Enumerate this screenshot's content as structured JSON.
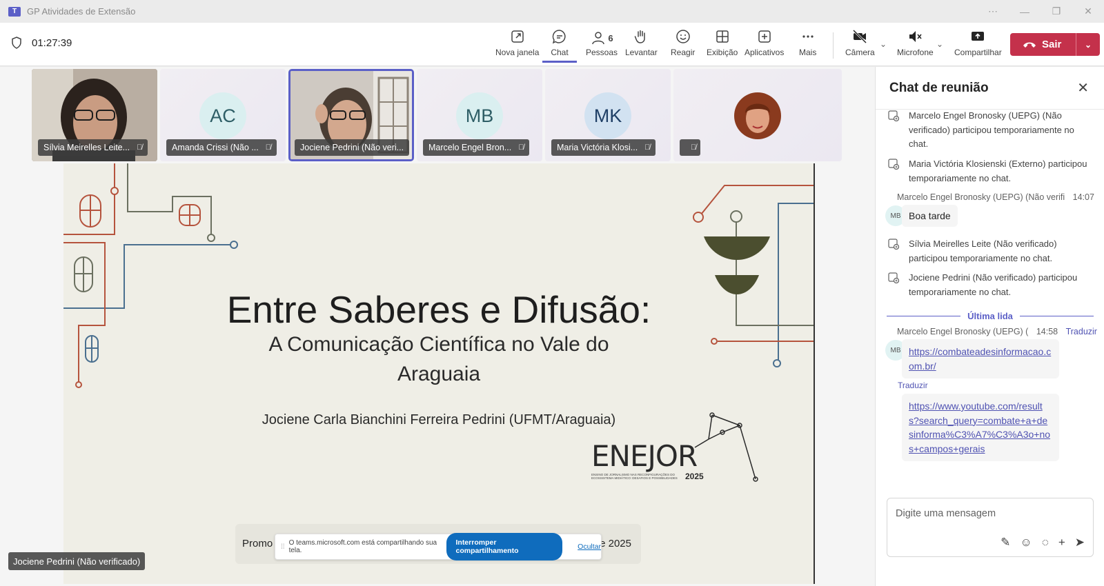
{
  "window": {
    "title": "GP Atividades de Extensão",
    "controls": [
      "⋯",
      "—",
      "❐",
      "✕"
    ]
  },
  "meeting": {
    "elapsed": "01:27:39"
  },
  "toolbar": {
    "nova_janela": "Nova janela",
    "chat": "Chat",
    "pessoas": "Pessoas",
    "pessoas_count": "6",
    "levantar": "Levantar",
    "reagir": "Reagir",
    "exibicao": "Exibição",
    "aplicativos": "Aplicativos",
    "mais": "Mais",
    "camera": "Câmera",
    "microfone": "Microfone",
    "compartilhar": "Compartilhar",
    "sair": "Sair"
  },
  "participants": [
    {
      "name": "Sílvia Meirelles Leite...",
      "initials": ""
    },
    {
      "name": "Amanda Crissi (Não ...",
      "initials": "AC"
    },
    {
      "name": "Jociene Pedrini (Não veri...",
      "initials": ""
    },
    {
      "name": "Marcelo Engel Bron...",
      "initials": "MB"
    },
    {
      "name": "Maria Victória Klosi...",
      "initials": "MK"
    },
    {
      "name": "",
      "initials": ""
    }
  ],
  "slide": {
    "title": "Entre Saberes e Difusão:",
    "subtitle_line1": "A Comunicação Científica no Vale do",
    "subtitle_line2": "Araguaia",
    "author": "Jociene Carla Bianchini Ferreira Pedrini (UFMT/Araguaia)",
    "logo_text": "ENEJOR",
    "logo_sub": "ENSINO DE JORNALISMO NAS RECONFIGURAÇÕES DO ECOSSISTEMA MIDIÁTICO: DESAFIOS E POSSIBILIDADES",
    "logo_year": "2025",
    "footer_left": "Promo",
    "footer_right": "e 2025"
  },
  "share_banner": {
    "text": "O teams.microsoft.com está compartilhando sua tela.",
    "stop": "Interromper compartilhamento",
    "hide": "Ocultar"
  },
  "presenter_label": "Jociene Pedrini (Não verificado)",
  "chat": {
    "title": "Chat de reunião",
    "sys1": "Marcelo Engel Bronosky (UEPG) (Não verificado) participou temporariamente no chat.",
    "sys2": "Maria Victória Klosienski (Externo) participou temporariamente no chat.",
    "msg1_author": "Marcelo Engel Bronosky (UEPG) (Não verifi",
    "msg1_time": "14:07",
    "msg1_initials": "MB",
    "msg1_text": "Boa tarde",
    "sys3": "Sílvia Meirelles Leite (Não verificado) participou temporariamente no chat.",
    "sys4": "Jociene Pedrini (Não verificado) participou temporariamente no chat.",
    "last_read": "Última lida",
    "msg2_author": "Marcelo Engel Bronosky (UEPG) (",
    "msg2_time": "14:58",
    "msg2_translate": "Traduzir",
    "msg2_initials": "MB",
    "msg2_link": "https://combateadesinformacao.com.br/",
    "msg3_translate": "Traduzir",
    "msg3_link": "https://www.youtube.com/results?search_query=combate+a+desinforma%C3%A7%C3%A3o+nos+campos+gerais",
    "compose_placeholder": "Digite uma mensagem"
  },
  "colors": {
    "accent": "#5b5fc7",
    "leave": "#c4314b",
    "link": "#4f52b2"
  }
}
